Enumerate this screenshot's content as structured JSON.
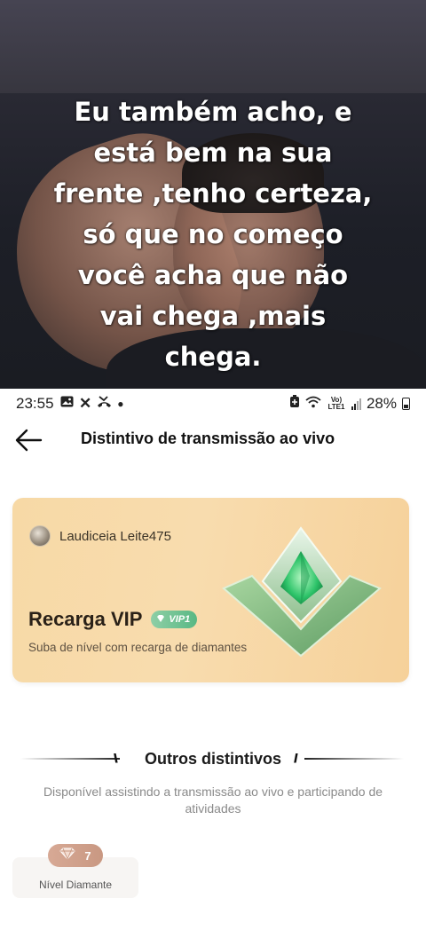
{
  "overlay": {
    "caption": "Eu também acho, e\nestá bem na sua\nfrente  ,tenho certeza,\nsó  que no começo\nvocê acha  que não\n vai chega  ,mais\nchega."
  },
  "status_bar": {
    "time": "23:55",
    "left_icons": [
      "gallery-icon",
      "x-icon",
      "missed-call-icon",
      "dot-icon"
    ],
    "battery_pct": "28%",
    "network": "Vo) LTE1"
  },
  "header": {
    "title": "Distintivo de transmissão ao vivo",
    "back_icon": "arrow-left-icon"
  },
  "vip_card": {
    "username": "Laudiceia Leite475",
    "title": "Recarga VIP",
    "badge": "VIP1",
    "subtitle": "Suba de nível com recarga de diamantes",
    "colors": {
      "card": "#f7d9a6",
      "badge_green": "#58b884"
    }
  },
  "others": {
    "section_title": "Outros distintivos",
    "description": "Disponível assistindo a transmissão ao vivo e participando de atividades",
    "items": [
      {
        "level": "7",
        "label": "Nível Diamante",
        "icon": "diamond-icon"
      }
    ]
  }
}
